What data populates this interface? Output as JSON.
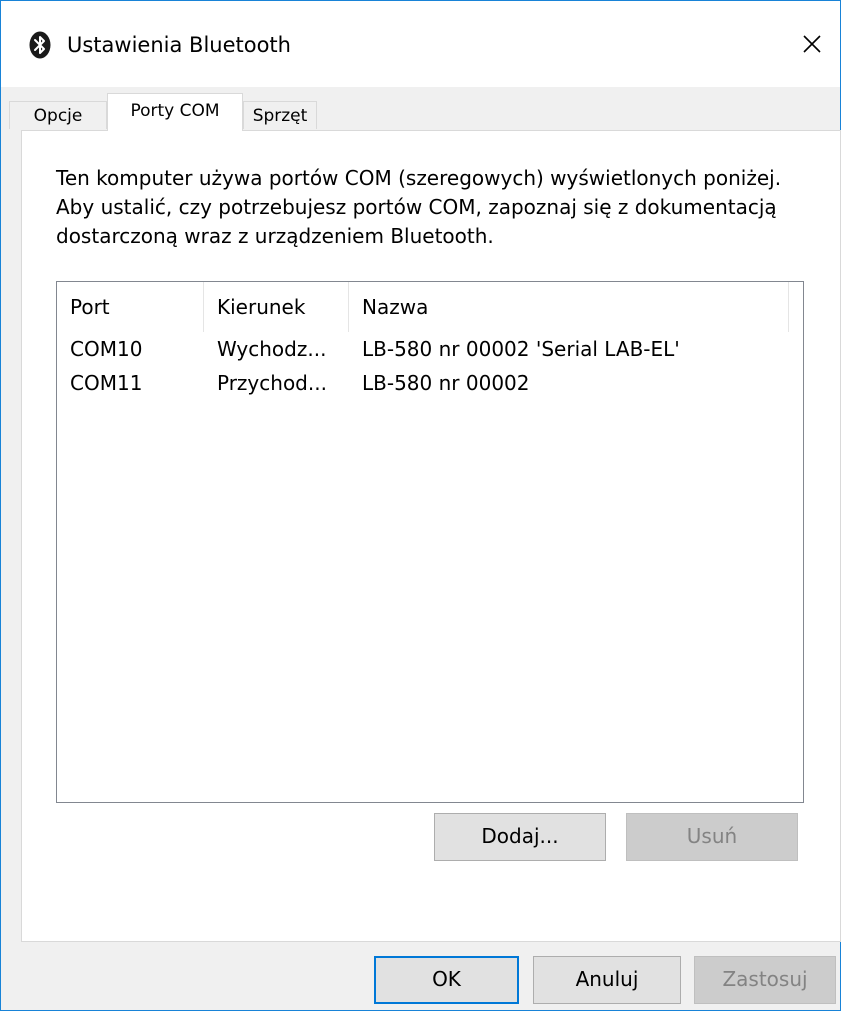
{
  "window": {
    "title": "Ustawienia Bluetooth",
    "title_icon": "bluetooth-icon",
    "close_icon": "close-icon"
  },
  "tabs": [
    {
      "label": "Opcje",
      "active": false
    },
    {
      "label": "Porty COM",
      "active": true
    },
    {
      "label": "Sprzęt",
      "active": false
    }
  ],
  "description": "Ten komputer używa portów COM (szeregowych) wyświetlonych poniżej. Aby ustalić, czy potrzebujesz portów COM, zapoznaj się z dokumentacją dostarczoną wraz z urządzeniem Bluetooth.",
  "ports_table": {
    "columns": [
      "Port",
      "Kierunek",
      "Nazwa"
    ],
    "rows": [
      {
        "port": "COM10",
        "direction": "Wychodz...",
        "name": "LB-580 nr 00002 'Serial LAB-EL'"
      },
      {
        "port": "COM11",
        "direction": "Przychod...",
        "name": "LB-580 nr 00002"
      }
    ]
  },
  "panel_buttons": {
    "add_label": "Dodaj...",
    "remove_label": "Usuń",
    "remove_enabled": false
  },
  "dialog_buttons": {
    "ok_label": "OK",
    "cancel_label": "Anuluj",
    "apply_label": "Zastosuj",
    "apply_enabled": false
  },
  "colors": {
    "accent": "#0078d7",
    "window_border": "#1883d7",
    "face": "#f0f0f0",
    "disabled_text": "#838383"
  }
}
